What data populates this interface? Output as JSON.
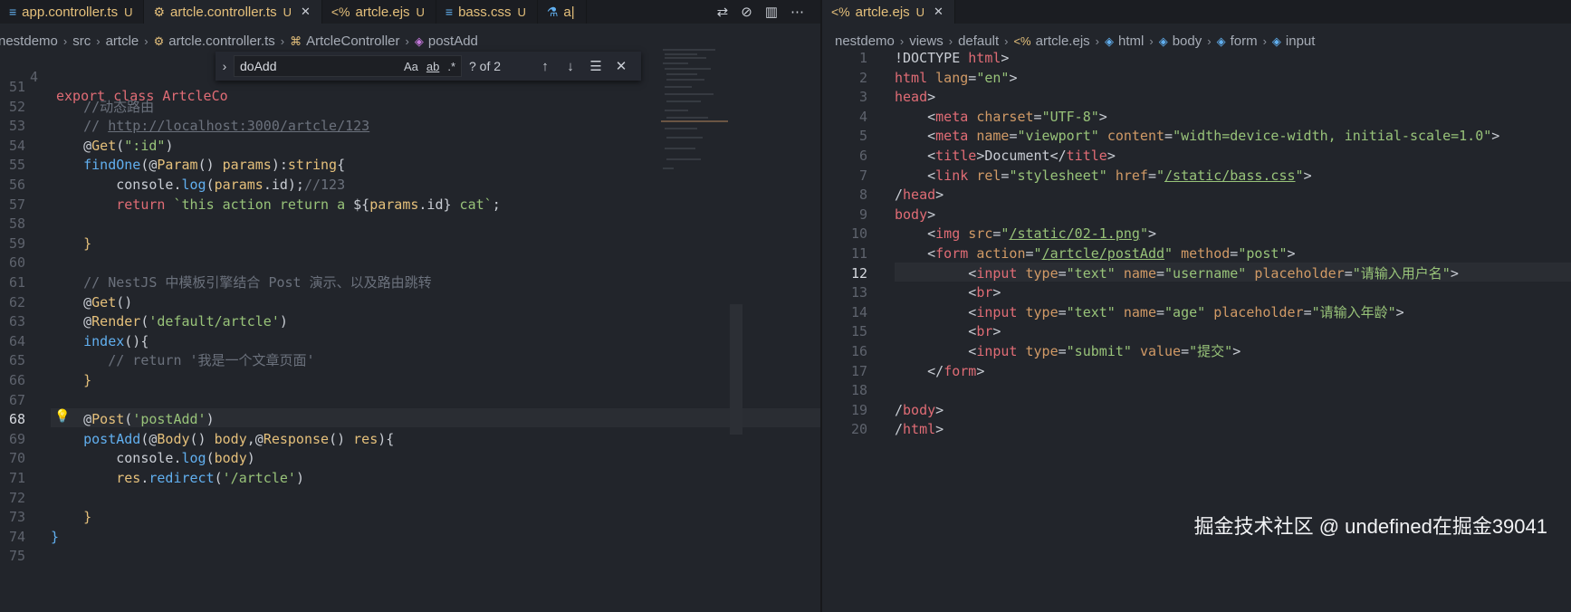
{
  "left": {
    "tabs": [
      {
        "label": "app.controller.ts",
        "mark": "U",
        "icon": "typescript-file-icon"
      },
      {
        "label": "artcle.controller.ts",
        "mark": "U",
        "icon": "gear-icon",
        "active": true
      },
      {
        "label": "artcle.ejs",
        "mark": "U",
        "icon": "ejs-file-icon"
      },
      {
        "label": "bass.css",
        "mark": "U",
        "icon": "css-file-icon"
      },
      {
        "label": "a|",
        "mark": "",
        "icon": "flask-icon"
      }
    ],
    "breadcrumbs": [
      "nestdemo",
      "src",
      "artcle",
      "artcle.controller.ts",
      "ArtcleController",
      "postAdd"
    ],
    "sticky": {
      "num": "4",
      "text": "export class ArtcleCo"
    },
    "find": {
      "query": "doAdd",
      "count": "? of 2",
      "case_label": "Aa",
      "word_label": "ab",
      "regex_label": ".*"
    },
    "lines": [
      {
        "num": "51",
        "segs": []
      },
      {
        "num": "52",
        "segs": [
          {
            "c": "cm",
            "t": "    //动态路由"
          }
        ]
      },
      {
        "num": "53",
        "segs": [
          {
            "c": "cm",
            "t": "    // "
          },
          {
            "c": "cm link",
            "t": "http://localhost:3000/artcle/123"
          }
        ]
      },
      {
        "num": "54",
        "segs": [
          {
            "c": "pl",
            "t": "    @"
          },
          {
            "c": "dec",
            "t": "Get"
          },
          {
            "c": "pl",
            "t": "("
          },
          {
            "c": "str",
            "t": "\":id\""
          },
          {
            "c": "pl",
            "t": ")"
          }
        ]
      },
      {
        "num": "55",
        "segs": [
          {
            "c": "fn",
            "t": "    findOne"
          },
          {
            "c": "pl",
            "t": "(@"
          },
          {
            "c": "dec",
            "t": "Param"
          },
          {
            "c": "pl",
            "t": "() "
          },
          {
            "c": "vr",
            "t": "params"
          },
          {
            "c": "pl",
            "t": "):"
          },
          {
            "c": "ty",
            "t": "string"
          },
          {
            "c": "pl",
            "t": "{"
          }
        ]
      },
      {
        "num": "56",
        "segs": [
          {
            "c": "pl",
            "t": "        console."
          },
          {
            "c": "fn",
            "t": "log"
          },
          {
            "c": "pl",
            "t": "("
          },
          {
            "c": "vr",
            "t": "params"
          },
          {
            "c": "pl",
            "t": ".id);"
          },
          {
            "c": "cm",
            "t": "//123"
          }
        ]
      },
      {
        "num": "57",
        "segs": [
          {
            "c": "kw",
            "t": "        return "
          },
          {
            "c": "str",
            "t": "`this action return a "
          },
          {
            "c": "pl",
            "t": "${"
          },
          {
            "c": "vr",
            "t": "params"
          },
          {
            "c": "pl",
            "t": ".id}"
          },
          {
            "c": "str",
            "t": " cat`"
          },
          {
            "c": "pl",
            "t": ";"
          }
        ]
      },
      {
        "num": "58",
        "segs": []
      },
      {
        "num": "59",
        "segs": [
          {
            "c": "dec",
            "t": "    }"
          }
        ]
      },
      {
        "num": "60",
        "segs": []
      },
      {
        "num": "61",
        "segs": [
          {
            "c": "cm",
            "t": "    // NestJS 中模板引擎结合 Post 演示、以及路由跳转"
          }
        ]
      },
      {
        "num": "62",
        "segs": [
          {
            "c": "pl",
            "t": "    @"
          },
          {
            "c": "dec",
            "t": "Get"
          },
          {
            "c": "pl",
            "t": "()"
          }
        ]
      },
      {
        "num": "63",
        "segs": [
          {
            "c": "pl",
            "t": "    @"
          },
          {
            "c": "dec",
            "t": "Render"
          },
          {
            "c": "pl",
            "t": "("
          },
          {
            "c": "str",
            "t": "'default/artcle'"
          },
          {
            "c": "pl",
            "t": ")"
          }
        ]
      },
      {
        "num": "64",
        "segs": [
          {
            "c": "fn",
            "t": "    index"
          },
          {
            "c": "pl",
            "t": "(){"
          }
        ]
      },
      {
        "num": "65",
        "segs": [
          {
            "c": "cm",
            "t": "       // return '我是一个文章页面'"
          }
        ]
      },
      {
        "num": "66",
        "segs": [
          {
            "c": "dec",
            "t": "    }"
          }
        ]
      },
      {
        "num": "67",
        "segs": []
      },
      {
        "num": "68",
        "segs": [
          {
            "c": "pl",
            "t": "    @"
          },
          {
            "c": "dec",
            "t": "Post"
          },
          {
            "c": "pl",
            "t": "("
          },
          {
            "c": "str",
            "t": "'postAdd'"
          },
          {
            "c": "pl",
            "t": ")"
          }
        ],
        "current": true
      },
      {
        "num": "69",
        "segs": [
          {
            "c": "fn",
            "t": "    postAdd"
          },
          {
            "c": "pl",
            "t": "(@"
          },
          {
            "c": "dec",
            "t": "Body"
          },
          {
            "c": "pl",
            "t": "() "
          },
          {
            "c": "vr",
            "t": "body"
          },
          {
            "c": "pl",
            "t": ",@"
          },
          {
            "c": "dec",
            "t": "Response"
          },
          {
            "c": "pl",
            "t": "() "
          },
          {
            "c": "vr",
            "t": "res"
          },
          {
            "c": "pl",
            "t": "){"
          }
        ]
      },
      {
        "num": "70",
        "segs": [
          {
            "c": "pl",
            "t": "        console."
          },
          {
            "c": "fn",
            "t": "log"
          },
          {
            "c": "pl",
            "t": "("
          },
          {
            "c": "vr",
            "t": "body"
          },
          {
            "c": "pl",
            "t": ")"
          }
        ]
      },
      {
        "num": "71",
        "segs": [
          {
            "c": "vr",
            "t": "        res"
          },
          {
            "c": "pl",
            "t": "."
          },
          {
            "c": "fn",
            "t": "redirect"
          },
          {
            "c": "pl",
            "t": "("
          },
          {
            "c": "str",
            "t": "'/artcle'"
          },
          {
            "c": "pl",
            "t": ")"
          }
        ]
      },
      {
        "num": "72",
        "segs": []
      },
      {
        "num": "73",
        "segs": [
          {
            "c": "dec",
            "t": "    }"
          }
        ]
      },
      {
        "num": "74",
        "segs": [
          {
            "c": "fn",
            "t": "}"
          }
        ]
      },
      {
        "num": "75",
        "segs": []
      }
    ]
  },
  "right": {
    "tab": {
      "label": "artcle.ejs",
      "mark": "U",
      "icon": "ejs-file-icon"
    },
    "breadcrumbs": [
      "nestdemo",
      "views",
      "default",
      "artcle.ejs",
      "html",
      "body",
      "form",
      "input"
    ],
    "lines": [
      {
        "num": "1",
        "segs": [
          {
            "c": "pl",
            "t": "!DOCTYPE "
          },
          {
            "c": "tag",
            "t": "html"
          },
          {
            "c": "pl",
            "t": ">"
          }
        ]
      },
      {
        "num": "2",
        "segs": [
          {
            "c": "tag",
            "t": "html "
          },
          {
            "c": "attr",
            "t": "lang"
          },
          {
            "c": "pl",
            "t": "="
          },
          {
            "c": "astr",
            "t": "\"en\""
          },
          {
            "c": "pl",
            "t": ">"
          }
        ]
      },
      {
        "num": "3",
        "segs": [
          {
            "c": "tag",
            "t": "head"
          },
          {
            "c": "pl",
            "t": ">"
          }
        ]
      },
      {
        "num": "4",
        "segs": [
          {
            "c": "pl",
            "t": "    <"
          },
          {
            "c": "tag",
            "t": "meta "
          },
          {
            "c": "attr",
            "t": "charset"
          },
          {
            "c": "pl",
            "t": "="
          },
          {
            "c": "astr",
            "t": "\"UTF-8\""
          },
          {
            "c": "pl",
            "t": ">"
          }
        ]
      },
      {
        "num": "5",
        "segs": [
          {
            "c": "pl",
            "t": "    <"
          },
          {
            "c": "tag",
            "t": "meta "
          },
          {
            "c": "attr",
            "t": "name"
          },
          {
            "c": "pl",
            "t": "="
          },
          {
            "c": "astr",
            "t": "\"viewport\" "
          },
          {
            "c": "attr",
            "t": "content"
          },
          {
            "c": "pl",
            "t": "="
          },
          {
            "c": "astr",
            "t": "\"width=device-width, initial-scale=1.0\""
          },
          {
            "c": "pl",
            "t": ">"
          }
        ]
      },
      {
        "num": "6",
        "segs": [
          {
            "c": "pl",
            "t": "    <"
          },
          {
            "c": "tag",
            "t": "title"
          },
          {
            "c": "pl",
            "t": ">Document</"
          },
          {
            "c": "tag",
            "t": "title"
          },
          {
            "c": "pl",
            "t": ">"
          }
        ]
      },
      {
        "num": "7",
        "segs": [
          {
            "c": "pl",
            "t": "    <"
          },
          {
            "c": "tag",
            "t": "link "
          },
          {
            "c": "attr",
            "t": "rel"
          },
          {
            "c": "pl",
            "t": "="
          },
          {
            "c": "astr",
            "t": "\"stylesheet\" "
          },
          {
            "c": "attr",
            "t": "href"
          },
          {
            "c": "pl",
            "t": "="
          },
          {
            "c": "astr",
            "t": "\""
          },
          {
            "c": "astr link",
            "t": "/static/bass.css"
          },
          {
            "c": "astr",
            "t": "\""
          },
          {
            "c": "pl",
            "t": ">"
          }
        ]
      },
      {
        "num": "8",
        "segs": [
          {
            "c": "pl",
            "t": "/"
          },
          {
            "c": "tag",
            "t": "head"
          },
          {
            "c": "pl",
            "t": ">"
          }
        ]
      },
      {
        "num": "9",
        "segs": [
          {
            "c": "tag",
            "t": "body"
          },
          {
            "c": "pl",
            "t": ">"
          }
        ]
      },
      {
        "num": "10",
        "segs": [
          {
            "c": "pl",
            "t": "    <"
          },
          {
            "c": "tag",
            "t": "img "
          },
          {
            "c": "attr",
            "t": "src"
          },
          {
            "c": "pl",
            "t": "="
          },
          {
            "c": "astr",
            "t": "\""
          },
          {
            "c": "astr link",
            "t": "/static/02-1.png"
          },
          {
            "c": "astr",
            "t": "\""
          },
          {
            "c": "pl",
            "t": ">"
          }
        ]
      },
      {
        "num": "11",
        "segs": [
          {
            "c": "pl",
            "t": "    <"
          },
          {
            "c": "tag",
            "t": "form "
          },
          {
            "c": "attr",
            "t": "action"
          },
          {
            "c": "pl",
            "t": "="
          },
          {
            "c": "astr",
            "t": "\""
          },
          {
            "c": "astr link",
            "t": "/artcle/postAdd"
          },
          {
            "c": "astr",
            "t": "\" "
          },
          {
            "c": "attr",
            "t": "method"
          },
          {
            "c": "pl",
            "t": "="
          },
          {
            "c": "astr",
            "t": "\"post\""
          },
          {
            "c": "pl",
            "t": ">"
          }
        ]
      },
      {
        "num": "12",
        "segs": [
          {
            "c": "pl",
            "t": "         <"
          },
          {
            "c": "tag",
            "t": "input "
          },
          {
            "c": "attr",
            "t": "type"
          },
          {
            "c": "pl",
            "t": "="
          },
          {
            "c": "astr",
            "t": "\"text\" "
          },
          {
            "c": "attr",
            "t": "name"
          },
          {
            "c": "pl",
            "t": "="
          },
          {
            "c": "astr",
            "t": "\"username\" "
          },
          {
            "c": "attr",
            "t": "placeholder"
          },
          {
            "c": "pl",
            "t": "="
          },
          {
            "c": "astr",
            "t": "\"请输入用户名\""
          },
          {
            "c": "pl",
            "t": ">"
          }
        ],
        "current": true
      },
      {
        "num": "13",
        "segs": [
          {
            "c": "pl",
            "t": "         <"
          },
          {
            "c": "tag",
            "t": "br"
          },
          {
            "c": "pl",
            "t": ">"
          }
        ]
      },
      {
        "num": "14",
        "segs": [
          {
            "c": "pl",
            "t": "         <"
          },
          {
            "c": "tag",
            "t": "input "
          },
          {
            "c": "attr",
            "t": "type"
          },
          {
            "c": "pl",
            "t": "="
          },
          {
            "c": "astr",
            "t": "\"text\" "
          },
          {
            "c": "attr",
            "t": "name"
          },
          {
            "c": "pl",
            "t": "="
          },
          {
            "c": "astr",
            "t": "\"age\" "
          },
          {
            "c": "attr",
            "t": "placeholder"
          },
          {
            "c": "pl",
            "t": "="
          },
          {
            "c": "astr",
            "t": "\"请输入年龄\""
          },
          {
            "c": "pl",
            "t": ">"
          }
        ]
      },
      {
        "num": "15",
        "segs": [
          {
            "c": "pl",
            "t": "         <"
          },
          {
            "c": "tag",
            "t": "br"
          },
          {
            "c": "pl",
            "t": ">"
          }
        ]
      },
      {
        "num": "16",
        "segs": [
          {
            "c": "pl",
            "t": "         <"
          },
          {
            "c": "tag",
            "t": "input "
          },
          {
            "c": "attr",
            "t": "type"
          },
          {
            "c": "pl",
            "t": "="
          },
          {
            "c": "astr",
            "t": "\"submit\" "
          },
          {
            "c": "attr",
            "t": "value"
          },
          {
            "c": "pl",
            "t": "="
          },
          {
            "c": "astr",
            "t": "\"提交\""
          },
          {
            "c": "pl",
            "t": ">"
          }
        ]
      },
      {
        "num": "17",
        "segs": [
          {
            "c": "pl",
            "t": "    </"
          },
          {
            "c": "tag",
            "t": "form"
          },
          {
            "c": "pl",
            "t": ">"
          }
        ]
      },
      {
        "num": "18",
        "segs": []
      },
      {
        "num": "19",
        "segs": [
          {
            "c": "pl",
            "t": "/"
          },
          {
            "c": "tag",
            "t": "body"
          },
          {
            "c": "pl",
            "t": ">"
          }
        ]
      },
      {
        "num": "20",
        "segs": [
          {
            "c": "pl",
            "t": "/"
          },
          {
            "c": "tag",
            "t": "html"
          },
          {
            "c": "pl",
            "t": ">"
          }
        ]
      }
    ]
  },
  "watermark": "掘金技术社区 @ undefined在掘金39041",
  "colors": {
    "accent": "#e5c07b",
    "background": "#22252b",
    "tag": "#e06c75",
    "string": "#98c379"
  }
}
